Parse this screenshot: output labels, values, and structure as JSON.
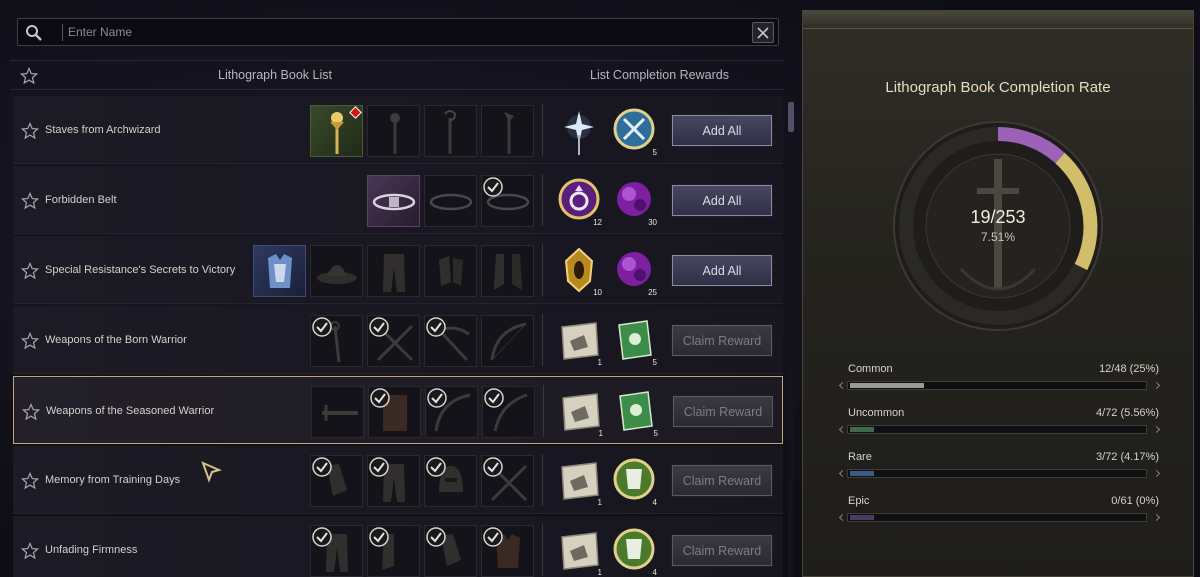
{
  "search": {
    "placeholder": "Enter Name"
  },
  "header": {
    "book_list_label": "Lithograph Book List",
    "rewards_label": "List Completion Rewards"
  },
  "rows": [
    {
      "name": "Staves from Archwizard",
      "button": "Add All",
      "button_enabled": true,
      "rewards": [
        {
          "icon": "sparkle-staff-icon",
          "count": ""
        },
        {
          "icon": "crossed-blades-medallion-icon",
          "count": "5"
        }
      ]
    },
    {
      "name": "Forbidden Belt",
      "button": "Add All",
      "button_enabled": true,
      "rewards": [
        {
          "icon": "purple-ring-medallion-icon",
          "count": "12"
        },
        {
          "icon": "purple-crystal-icon",
          "count": "30"
        }
      ]
    },
    {
      "name": "Special Resistance's Secrets to Victory",
      "button": "Add All",
      "button_enabled": true,
      "rewards": [
        {
          "icon": "golden-amulet-icon",
          "count": "10"
        },
        {
          "icon": "purple-crystal-icon",
          "count": "25"
        }
      ]
    },
    {
      "name": "Weapons of the Born Warrior",
      "button": "Claim Reward",
      "button_enabled": false,
      "rewards": [
        {
          "icon": "scroll-icon",
          "count": "1"
        },
        {
          "icon": "green-book-icon",
          "count": "5"
        }
      ]
    },
    {
      "name": "Weapons of the Seasoned Warrior",
      "button": "Claim Reward",
      "button_enabled": false,
      "rewards": [
        {
          "icon": "scroll-icon",
          "count": "1"
        },
        {
          "icon": "green-book-icon",
          "count": "5"
        }
      ]
    },
    {
      "name": "Memory from Training Days",
      "button": "Claim Reward",
      "button_enabled": false,
      "rewards": [
        {
          "icon": "scroll-icon",
          "count": "1"
        },
        {
          "icon": "green-armor-medallion-icon",
          "count": "4"
        }
      ]
    },
    {
      "name": "Unfading Firmness",
      "button": "Claim Reward",
      "button_enabled": false,
      "rewards": [
        {
          "icon": "scroll-icon",
          "count": "1"
        },
        {
          "icon": "green-armor-medallion-icon",
          "count": "4"
        }
      ]
    }
  ],
  "completion": {
    "title": "Lithograph Book Completion Rate",
    "ratio": "19/253",
    "percent": "7.51%",
    "progress": 0.0751,
    "stats": [
      {
        "name": "Common",
        "value": "12/48 (25%)",
        "fraction": 0.25,
        "color": "#9a9a9a"
      },
      {
        "name": "Uncommon",
        "value": "4/72 (5.56%)",
        "fraction": 0.0556,
        "color": "#3d6a4a"
      },
      {
        "name": "Rare",
        "value": "3/72 (4.17%)",
        "fraction": 0.0417,
        "color": "#3b5a84"
      },
      {
        "name": "Epic",
        "value": "0/61 (0%)",
        "fraction": 0.0,
        "color": "#4c3a60"
      }
    ]
  }
}
